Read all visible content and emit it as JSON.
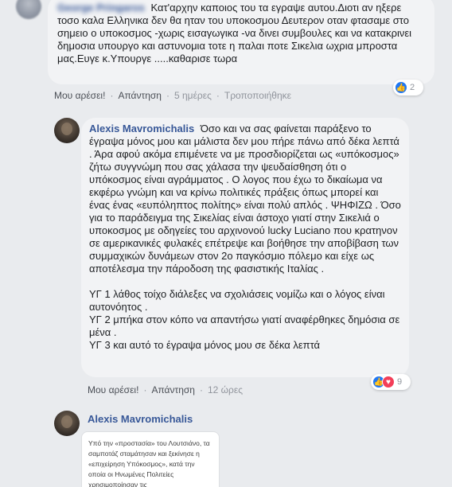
{
  "comment1": {
    "author": "George Pringaros",
    "text": "Κατ'αρχην καποιος του τα εγραψε αυτου.Διοτι αν ηξερε τοσο καλα Ελληνικα δεν θα ηταν του υποκοσμου Δευτερον οταν φτασαμε στο σημειο ο υποκοσμος -χωρις εισαγωγικα -να δινει συμβουλες και να κατακρινει δημοσια υπουργο και αστυνομια τοτε η παλαι ποτε Σικελια ωχρια μπροστα μας.Ευγε κ.Υπουργε .....καθαρισε τωρα",
    "like": "Μου αρέσει!",
    "reply": "Απάντηση",
    "time": "5 ημέρες",
    "edited": "Τροποποιήθηκε",
    "reactions_count": "2"
  },
  "comment2": {
    "author": "Alexis Mavromichalis",
    "p1": "Όσο και να σας φαίνεται παράξενο το έγραψα μόνος μου και μάλιστα δεν μου πήρε πάνω από δέκα λεπτά . Άρα αφού ακόμα επιμένετε να με προσδιορίζεται ως «υπόκοσμος» ζήτω συγγνώμη που σας χάλασα την ψευδαίσθηση ότι ο υπόκοσμος είναι αγράμματος . Ο λογος που έχω το δικαίωμα να εκφέρω γνώμη και να κρίνω πολιτικές πράξεις όπως μπορεί και ένας ένας «ευπόληπτος πολίτης» είναι πολύ απλός . ΨΗΦΙΖΩ . Όσο για το παράδειγμα της Σικελίας είναι άστοχο γιατί στην Σικελιά ο υποκοσμος με οδηγείες του αρχινονού lucky Luciano που κρατηνον σε αμερικανικές φυλακές επέτρεψε και βοήθησε την αποβίβαση των συμμαχικών δυνάμεων στον 2ο παγκόσμιο πόλεμο και είχε ως αποτέλεσμα την πάροδοση της φασιστικής Ιταλίας .",
    "p2": "ΥΓ 1 λάθος τοίχο διάλεξες να σχολιάσεις νομίζω και ο λόγος είναι αυτονόητος .",
    "p3": "ΥΓ 2 μπήκα στον κόπο να απαντήσω γιατί αναφέρθηκες δημόσια σε μένα .",
    "p4": "ΥΓ 3 και αυτό το έγραψα μόνος μου σε δέκα λεπτά",
    "like": "Μου αρέσει!",
    "reply": "Απάντηση",
    "time": "12 ώρες",
    "reactions_count": "9"
  },
  "comment3": {
    "author": "Alexis Mavromichalis",
    "attachment_text": "Υπό την «προστασία» του Λουτσιάνο, τα σαμποτάζ σταμάτησαν και ξεκίνησε η «επιχείρηση Υπόκοσμος», κατά την οποία οι Ηνωμένες Πολιτείες χρησιμοποίησαν τις"
  },
  "colors": {
    "link": "#385898",
    "like": "#2078f4",
    "love": "#f33e58",
    "bubble": "#f2f3f5",
    "bg": "#e9ebee"
  }
}
